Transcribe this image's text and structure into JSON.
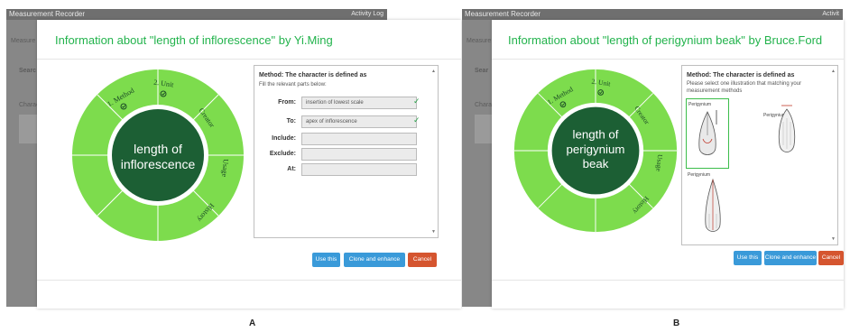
{
  "panels": [
    {
      "app": {
        "title": "Measurement Recorder",
        "activity_log": "Activity Log",
        "ghost": [
          "Measure",
          "Searc",
          "Charac"
        ]
      },
      "modal": {
        "title": "Information about \"length of inflorescence\" by Yi.Ming",
        "wheel": {
          "center_label": [
            "length of",
            "inflorescence"
          ],
          "segments": [
            "1. Method",
            "2. Unit",
            "Creator",
            "Usage",
            "History"
          ]
        },
        "method_panel": {
          "title": "Method: The character is defined as",
          "subtitle": "Fill the relevant parts below:",
          "fields": [
            {
              "label": "From:",
              "value": "insertion of lowest scale",
              "checked": true
            },
            {
              "label": "To:",
              "value": "apex of inflorescence",
              "checked": true
            },
            {
              "label": "Include:",
              "value": "",
              "checked": false
            },
            {
              "label": "Exclude:",
              "value": "",
              "checked": false
            },
            {
              "label": "At:",
              "value": "",
              "checked": false
            }
          ]
        },
        "buttons": {
          "use": "Use this",
          "clone": "Clone and enhance",
          "cancel": "Cancel"
        }
      },
      "caption": "A"
    },
    {
      "app": {
        "title": "Measurement Recorder",
        "activity_log": "Activit",
        "ghost": [
          "Measure",
          "Sear",
          "Charac"
        ]
      },
      "modal": {
        "title": "Information about \"length of perigynium beak\" by Bruce.Ford",
        "wheel": {
          "center_label": [
            "length of",
            "perigynium",
            "beak"
          ],
          "segments": [
            "1. Method",
            "2. Unit",
            "Creator",
            "Usage",
            "History"
          ]
        },
        "method_panel": {
          "title": "Method: The character is defined as",
          "subtitle": "Please select one illustration that matching your measurement methods",
          "illustration_labels": [
            "Perigynium",
            "Perigynium",
            "Perigynium"
          ]
        },
        "buttons": {
          "use": "Use this",
          "clone": "Clone and enhance",
          "cancel": "Cancel"
        }
      },
      "caption": "B"
    }
  ],
  "colors": {
    "title_green": "#22b34c",
    "wheel_light": "#7ddc4d",
    "wheel_dark": "#1c5f34",
    "button_blue": "#3a9ad9",
    "button_red": "#d5552f",
    "check_green": "#2aa14a"
  },
  "icons": [
    "check-circle-icon",
    "checkmark-icon",
    "scroll-up-icon",
    "scroll-down-icon"
  ]
}
